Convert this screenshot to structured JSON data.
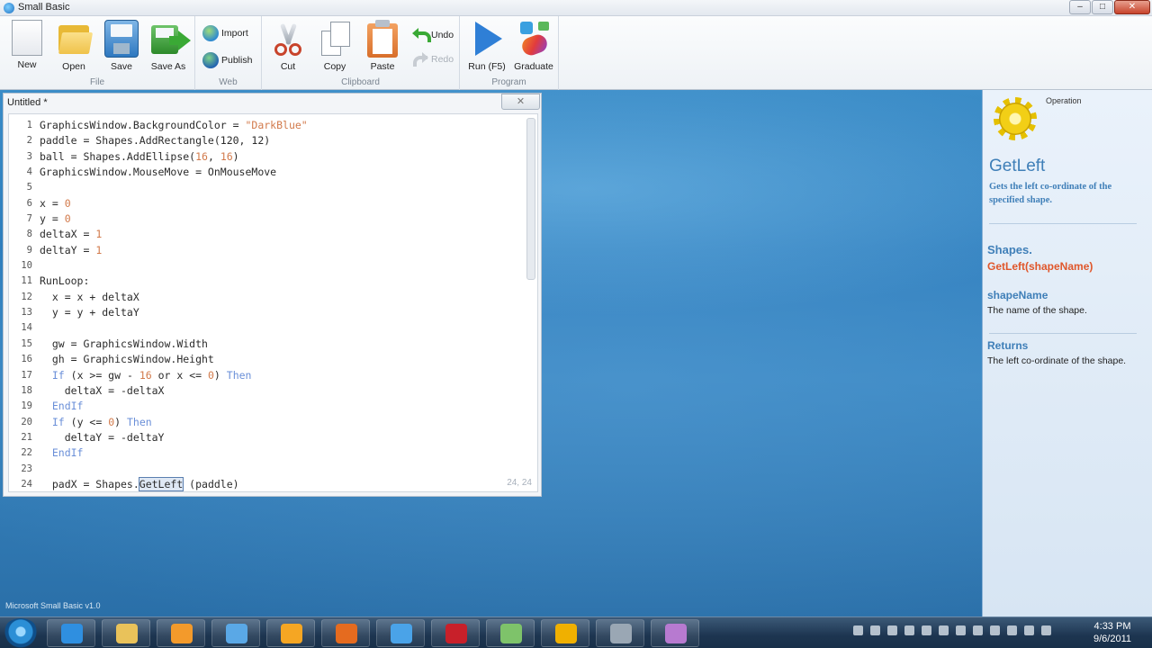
{
  "window": {
    "title": "Small Basic",
    "controls": [
      "–",
      "□",
      "✕"
    ]
  },
  "ribbon": {
    "groups": [
      {
        "label": "File"
      },
      {
        "label": "Web"
      },
      {
        "label": "Clipboard"
      },
      {
        "label": "Program"
      }
    ],
    "buttons": {
      "new": "New",
      "open": "Open",
      "save": "Save",
      "save_as": "Save As",
      "import": "Import",
      "publish": "Publish",
      "cut": "Cut",
      "copy": "Copy",
      "paste": "Paste",
      "undo": "Undo",
      "redo": "Redo",
      "run": "Run (F5)",
      "graduate": "Graduate"
    }
  },
  "editor": {
    "title": "Untitled *",
    "close": "✕",
    "cursor_position": "24, 24",
    "lines": [
      {
        "n": "1",
        "html": "GraphicsWindow.BackgroundColor = <span class=\"str\">\"DarkBlue\"</span>"
      },
      {
        "n": "2",
        "html": "paddle = Shapes.AddRectangle(120, 12)"
      },
      {
        "n": "3",
        "html": "ball = Shapes.AddEllipse(<span class=\"num\">16</span>, <span class=\"num\">16</span>)"
      },
      {
        "n": "4",
        "html": "GraphicsWindow.MouseMove = OnMouseMove"
      },
      {
        "n": "5",
        "html": ""
      },
      {
        "n": "6",
        "html": "x = <span class=\"num\">0</span>"
      },
      {
        "n": "7",
        "html": "y = <span class=\"num\">0</span>"
      },
      {
        "n": "8",
        "html": "deltaX = <span class=\"num\">1</span>"
      },
      {
        "n": "9",
        "html": "deltaY = <span class=\"num\">1</span>"
      },
      {
        "n": "10",
        "html": ""
      },
      {
        "n": "11",
        "html": "RunLoop:"
      },
      {
        "n": "12",
        "html": "  x = x + deltaX"
      },
      {
        "n": "13",
        "html": "  y = y + deltaY"
      },
      {
        "n": "14",
        "html": ""
      },
      {
        "n": "15",
        "html": "  gw = GraphicsWindow.Width"
      },
      {
        "n": "16",
        "html": "  gh = GraphicsWindow.Height"
      },
      {
        "n": "17",
        "html": "  <span class=\"kw\">If</span> (x >= gw - <span class=\"num\">16</span> or x <= <span class=\"num\">0</span>) <span class=\"kw\">Then</span>"
      },
      {
        "n": "18",
        "html": "    deltaX = -deltaX"
      },
      {
        "n": "19",
        "html": "  <span class=\"kw\">EndIf</span>"
      },
      {
        "n": "20",
        "html": "  <span class=\"kw\">If</span> (y <= <span class=\"num\">0</span>) <span class=\"kw\">Then</span>"
      },
      {
        "n": "21",
        "html": "    deltaY = -deltaY"
      },
      {
        "n": "22",
        "html": "  <span class=\"kw\">EndIf</span>"
      },
      {
        "n": "23",
        "html": ""
      },
      {
        "n": "24",
        "html": "  padX = Shapes.<span class=\"sel\">GetLeft</span> (paddle)"
      }
    ]
  },
  "help": {
    "operation_label": "Operation",
    "name": "GetLeft",
    "description": "Gets the left co-ordinate of the specified shape.",
    "object": "Shapes.",
    "signature": "GetLeft(shapeName)",
    "param_name": "shapeName",
    "param_desc": "The name of the shape.",
    "returns_label": "Returns",
    "returns_desc": "The left co-ordinate of the shape."
  },
  "footer": {
    "version": "Microsoft Small Basic v1.0"
  },
  "taskbar": {
    "items": [
      {
        "name": "internet-explorer",
        "color": "#2f8fe0"
      },
      {
        "name": "file-explorer",
        "color": "#e9c25a"
      },
      {
        "name": "media-player",
        "color": "#f39a2b"
      },
      {
        "name": "windows",
        "color": "#5aa8e6"
      },
      {
        "name": "bing",
        "color": "#f5a623"
      },
      {
        "name": "firefox",
        "color": "#e56b1f"
      },
      {
        "name": "itunes",
        "color": "#4aa3e8"
      },
      {
        "name": "acrobat",
        "color": "#c8202a"
      },
      {
        "name": "small-basic",
        "color": "#7ec36a"
      },
      {
        "name": "outlook",
        "color": "#f0b000"
      },
      {
        "name": "editor-app",
        "color": "#9aa7b4"
      },
      {
        "name": "video-app",
        "color": "#b77ad0"
      }
    ],
    "clock_time": "4:33 PM",
    "clock_date": "9/6/2011"
  }
}
